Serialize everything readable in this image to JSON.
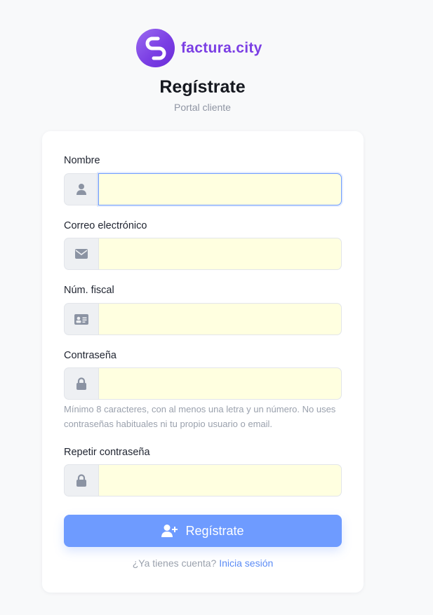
{
  "brand": {
    "name": "factura.city",
    "color": "#7b3fe4"
  },
  "header": {
    "title": "Regístrate",
    "subtitle": "Portal cliente"
  },
  "form": {
    "fields": [
      {
        "label": "Nombre",
        "icon": "user-icon",
        "value": ""
      },
      {
        "label": "Correo electrónico",
        "icon": "envelope-icon",
        "value": ""
      },
      {
        "label": "Núm. fiscal",
        "icon": "id-card-icon",
        "value": ""
      },
      {
        "label": "Contraseña",
        "icon": "lock-icon",
        "value": ""
      },
      {
        "label": "Repetir contraseña",
        "icon": "lock-icon",
        "value": ""
      }
    ],
    "password_help": "Mínimo 8 caracteres, con al menos una letra y un número. No uses contraseñas habituales ni tu propio usuario o email.",
    "submit_label": "Regístrate",
    "submit_icon": "user-plus-icon"
  },
  "footer": {
    "prompt": "¿Ya tienes cuenta? ",
    "link_label": "Inicia sesión"
  },
  "colors": {
    "accent": "#6e9bff",
    "autofill": "#ffffe0",
    "link": "#5b8bf5"
  }
}
